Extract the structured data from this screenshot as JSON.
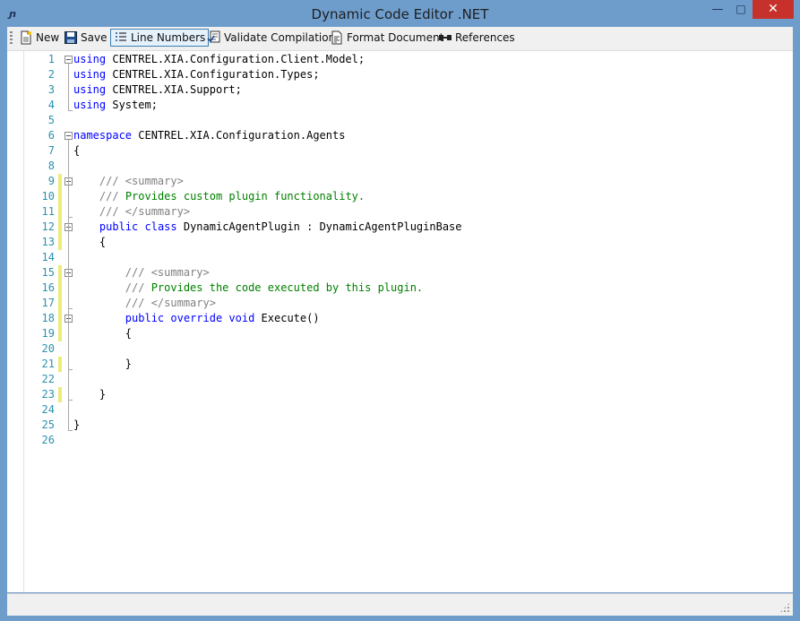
{
  "window": {
    "title": "Dynamic Code Editor .NET",
    "buttons": {
      "minimize": "—",
      "maximize": "□",
      "close": "✕"
    }
  },
  "toolbar": {
    "new_label": "New",
    "save_label": "Save",
    "line_numbers_label": "Line Numbers",
    "line_numbers_checked": true,
    "validate_label": "Validate Compilation",
    "format_label": "Format Document",
    "references_label": "References"
  },
  "editor": {
    "lines": [
      {
        "n": "1",
        "code": "using CENTREL.XIA.Configuration.Client.Model;"
      },
      {
        "n": "2",
        "code": "using CENTREL.XIA.Configuration.Types;"
      },
      {
        "n": "3",
        "code": "using CENTREL.XIA.Support;"
      },
      {
        "n": "4",
        "code": "using System;"
      },
      {
        "n": "5",
        "code": ""
      },
      {
        "n": "6",
        "code": "namespace CENTREL.XIA.Configuration.Agents"
      },
      {
        "n": "7",
        "code": "{"
      },
      {
        "n": "8",
        "code": ""
      },
      {
        "n": "9",
        "code": "    /// <summary>"
      },
      {
        "n": "10",
        "code": "    /// Provides custom plugin functionality."
      },
      {
        "n": "11",
        "code": "    /// </summary>"
      },
      {
        "n": "12",
        "code": "    public class DynamicAgentPlugin : DynamicAgentPluginBase"
      },
      {
        "n": "13",
        "code": "    {"
      },
      {
        "n": "14",
        "code": ""
      },
      {
        "n": "15",
        "code": "        /// <summary>"
      },
      {
        "n": "16",
        "code": "        /// Provides the code executed by this plugin."
      },
      {
        "n": "17",
        "code": "        /// </summary>"
      },
      {
        "n": "18",
        "code": "        public override void Execute()"
      },
      {
        "n": "19",
        "code": "        {"
      },
      {
        "n": "20",
        "code": ""
      },
      {
        "n": "21",
        "code": "        }"
      },
      {
        "n": "22",
        "code": ""
      },
      {
        "n": "23",
        "code": "    }"
      },
      {
        "n": "24",
        "code": ""
      },
      {
        "n": "25",
        "code": "}"
      },
      {
        "n": "26",
        "code": ""
      }
    ]
  },
  "colors": {
    "keyword": "#0000ff",
    "comment": "#008000",
    "doc_tag": "#808080",
    "line_number": "#2b91af",
    "changed_marker": "#ecec7a",
    "close_button": "#c7312b"
  }
}
